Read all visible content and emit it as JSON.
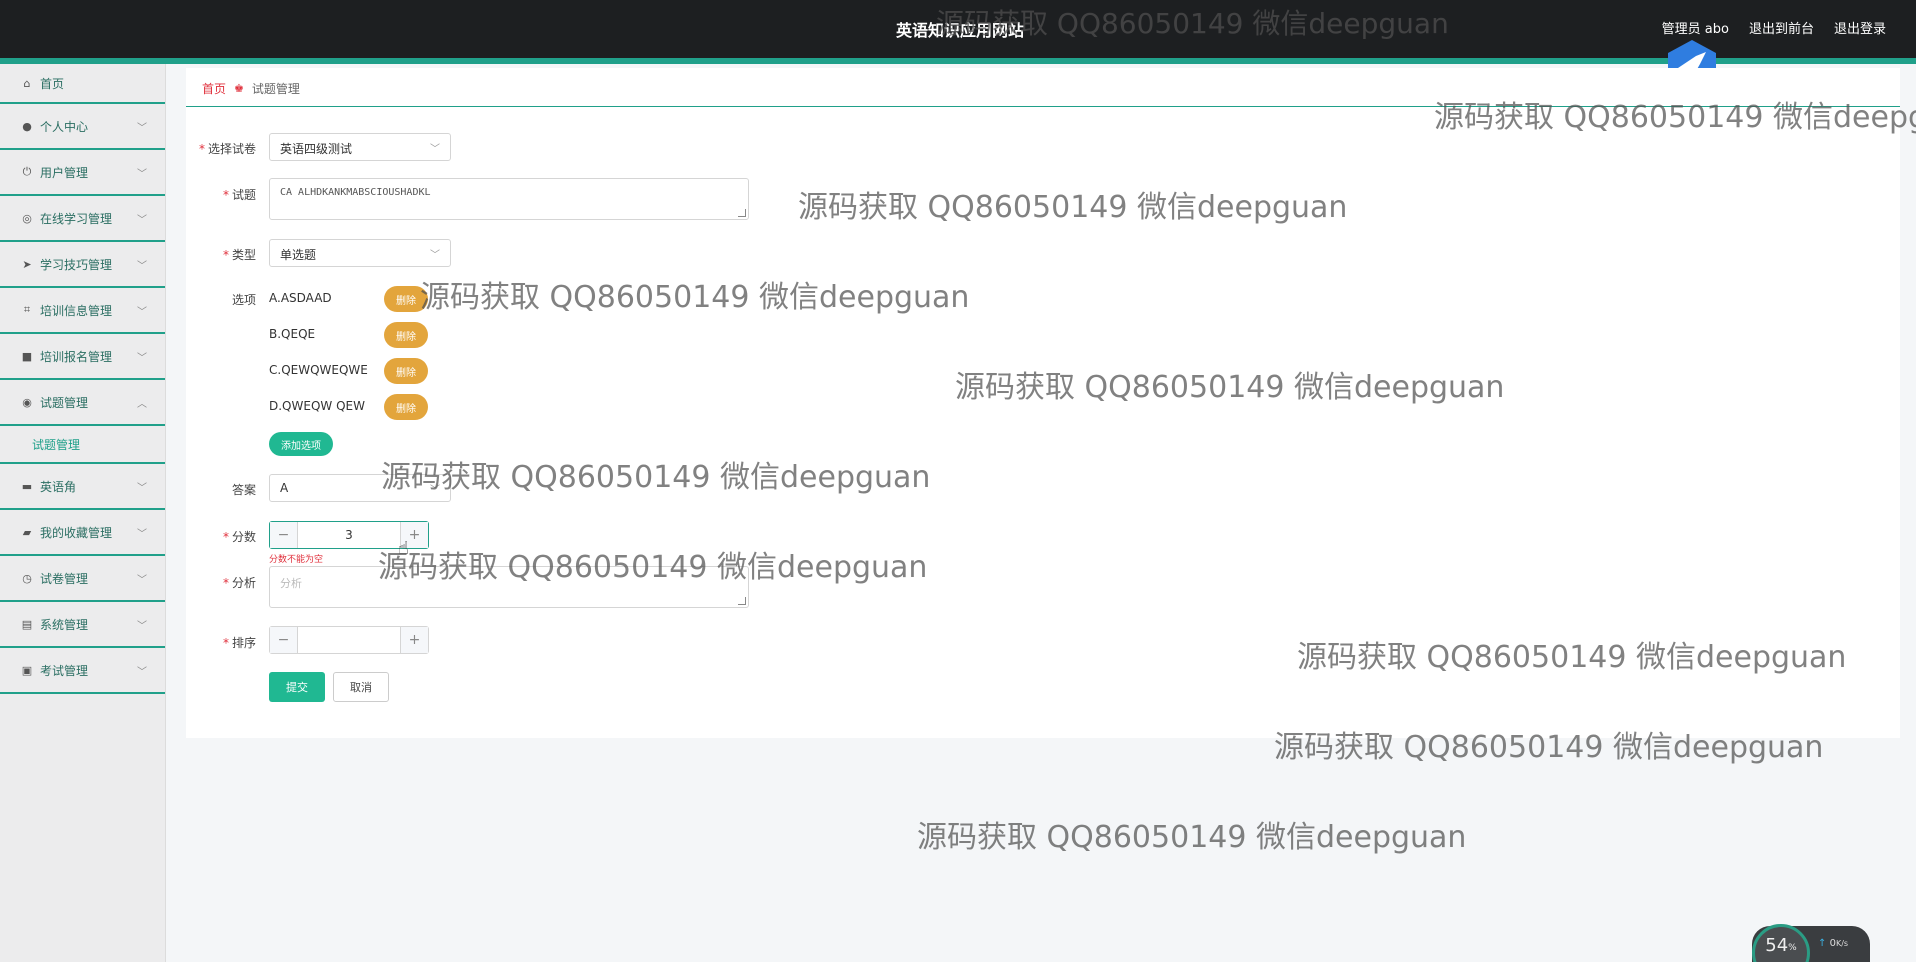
{
  "header": {
    "site_title": "英语知识应用网站",
    "user_label": "管理员 abo",
    "front_link": "退出到前台",
    "logout_link": "退出登录"
  },
  "sidebar": {
    "items": [
      {
        "label": "首页",
        "icon": "home-icon",
        "expandable": false
      },
      {
        "label": "个人中心",
        "icon": "user-icon",
        "expandable": true
      },
      {
        "label": "用户管理",
        "icon": "power-icon",
        "expandable": true
      },
      {
        "label": "在线学习管理",
        "icon": "compass-icon",
        "expandable": true
      },
      {
        "label": "学习技巧管理",
        "icon": "send-icon",
        "expandable": true
      },
      {
        "label": "培训信息管理",
        "icon": "crop-icon",
        "expandable": true
      },
      {
        "label": "培训报名管理",
        "icon": "chat-icon",
        "expandable": true
      },
      {
        "label": "试题管理",
        "icon": "target-icon",
        "expandable": true,
        "expanded": true
      },
      {
        "label": "英语角",
        "icon": "briefcase-icon",
        "expandable": true
      },
      {
        "label": "我的收藏管理",
        "icon": "bookmark-icon",
        "expandable": true
      },
      {
        "label": "试卷管理",
        "icon": "clock-icon",
        "expandable": true
      },
      {
        "label": "系统管理",
        "icon": "clipboard-icon",
        "expandable": true
      },
      {
        "label": "考试管理",
        "icon": "clipboard-check-icon",
        "expandable": true
      }
    ],
    "submenu": {
      "label": "试题管理"
    }
  },
  "breadcrumb": {
    "home": "首页",
    "current": "试题管理"
  },
  "form": {
    "paper_label": "选择试卷",
    "paper_value": "英语四级测试",
    "question_label": "试题",
    "question_value": "CA ALHDKANKMABSCIOUSHADKL",
    "type_label": "类型",
    "type_value": "单选题",
    "options_label": "选项",
    "options": [
      {
        "text": "A.ASDAAD",
        "delete_label": "删除"
      },
      {
        "text": "B.QEQE",
        "delete_label": "删除"
      },
      {
        "text": "C.QEWQWEQWE",
        "delete_label": "删除"
      },
      {
        "text": "D.QWEQW QEW",
        "delete_label": "删除"
      }
    ],
    "add_option_label": "添加选项",
    "answer_label": "答案",
    "answer_value": "A",
    "score_label": "分数",
    "score_value": "3",
    "score_error": "分数不能为空",
    "analysis_label": "分析",
    "analysis_placeholder": "分析",
    "order_label": "排序",
    "order_value": "",
    "submit_label": "提交",
    "cancel_label": "取消",
    "required_mark": "*"
  },
  "watermark_text": "源码获取 QQ86050149 微信deepguan",
  "speed_widget": {
    "value": "54",
    "unit": "%",
    "net_speed": "0",
    "net_unit": "K/s"
  },
  "colors": {
    "accent": "#20a08a",
    "button_green": "#20b892",
    "delete_orange": "#e3a53c",
    "error_red": "#e0303c",
    "topbar": "#1d1f21"
  }
}
